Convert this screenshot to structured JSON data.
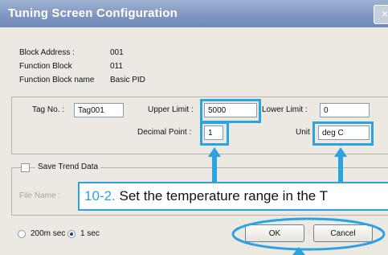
{
  "window": {
    "title": "Tuning Screen Configuration",
    "close_glyph": "×"
  },
  "info": {
    "block_address_label": "Block Address :",
    "block_address_value": "001",
    "function_block_label": "Function Block",
    "function_block_value": "011",
    "function_block_name_label": "Function Block name",
    "function_block_name_value": "Basic PID"
  },
  "fields": {
    "tag_label": "Tag No. :",
    "tag_value": "Tag001",
    "upper_label": "Upper Limit :",
    "upper_value": "5000",
    "lower_label": "Lower Limit :",
    "lower_value": "0",
    "decimal_label": "Decimal Point :",
    "decimal_value": "1",
    "unit_label": "Unit :",
    "unit_value": "deg C"
  },
  "trend": {
    "save_label": "Save Trend Data",
    "save_checked": false,
    "file_label": "File Name :"
  },
  "sampling": {
    "options": [
      "200m sec",
      "1 sec"
    ],
    "selected": "1 sec"
  },
  "buttons": {
    "ok": "OK",
    "cancel": "Cancel"
  },
  "callout": {
    "number": "10-2.",
    "text": "Set the temperature range in the T"
  },
  "colors": {
    "highlight": "#2aa3e0",
    "titlebar": "#7d95bf"
  }
}
